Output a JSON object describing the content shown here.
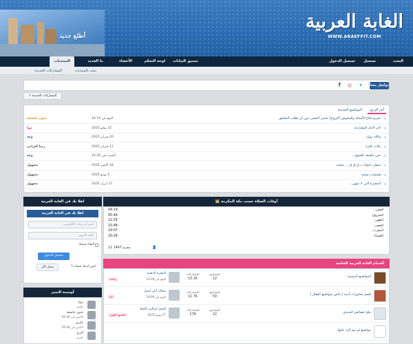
{
  "header": {
    "brand_title": "الغابة العربية",
    "brand_url": "WWW.ARAEFFIT.COM",
    "logo_caption": "أطلع جديد",
    "colors": {
      "header": "#2b6cb0",
      "nav": "#10263f",
      "accent": "#e8457c",
      "link": "#1f4e7d"
    }
  },
  "nav": {
    "items": [
      "المنتديات",
      "ما الجديد",
      "الأعضاء",
      "لوحة التحكم",
      "تنسيق البيانات",
      "تسجيل الدخول",
      "تسجيل",
      "البحث"
    ]
  },
  "subnav": {
    "items": [
      "المشاركات الجديدة",
      "بحث بالمنتديات"
    ]
  },
  "social": {
    "title": "تواصل معنا",
    "icons": [
      "twitter-icon",
      "instagram-icon",
      "facebook-icon"
    ]
  },
  "new_posts_label": "المشاركات الجديدة",
  "tabs": [
    "آخر الردود",
    "المواضيع الجديدة"
  ],
  "topics": [
    {
      "title": "تحريم فتاح الأسئلة والنصوص (الزواج) تحمي المعنى دون أن تطلب التحقيق",
      "date": "اليوم في 16:16",
      "user": "جنون عاشقة",
      "user_color": "#e39a1b"
    },
    {
      "title": "آخر أخبار المصارعة",
      "date": "21 يوليو 2025",
      "user": "مها",
      "user_color": "#e8457c"
    },
    {
      "title": "وكالة روح...",
      "date": "20 فبراير 2025",
      "user": "وعد",
      "user_color": "#2a4f7a"
    },
    {
      "title": "نكات نافرة",
      "date": "11 فبراير 2025",
      "user": "رضا الترابي",
      "user_color": "#555"
    },
    {
      "title": "حين يكشف الشوق...",
      "date": "السبت في 22:30",
      "user": "وعد",
      "user_color": "#2a4f7a"
    },
    {
      "title": "سجل دخولك بـ ق ق ق ...  متجدد",
      "date": "18 أكتوبر 2024",
      "user": "مجهول",
      "user_color": "#555"
    },
    {
      "title": "همسات نسمة",
      "date": "5 يونيو 2025",
      "user": "مجهول",
      "user_color": "#555"
    },
    {
      "title": "المحبرة التي لا تنتهي...",
      "date": "27 أبريل 2025",
      "user": "مجهول",
      "user_color": "#555"
    }
  ],
  "prayer": {
    "title": "أوقات الصلاة حسب مكة المكرمة",
    "rows": [
      {
        "label": "الفجر:",
        "time": "04:19"
      },
      {
        "label": "الشروق:",
        "time": "05:44"
      },
      {
        "label": "الظهر:",
        "time": "12:25"
      },
      {
        "label": "العصر:",
        "time": "15:48"
      },
      {
        "label": "المغرب:",
        "time": "19:07"
      },
      {
        "label": "العشاء:",
        "time": "20:26"
      }
    ],
    "hijri": "11 محرم 1447"
  },
  "forums": {
    "title": "أقسام الغابة العربية الخاصة",
    "rows": [
      {
        "name": "المواضيع المميزة",
        "topics": "12",
        "posts": "10.1K",
        "last_title": "المجرة الذهبية",
        "last_date": "اليوم في 13:28",
        "last_user": "راشد",
        "topics_label": "المواضيع",
        "posts_label": "المشاركات"
      },
      {
        "name": "قسم محاورات أدبية | خاص بمواضيع الفعال |",
        "topics": "50",
        "posts": "11.7K",
        "last_title": "سجال آنان جميل",
        "last_date": "اليوم في 16:09",
        "last_user": "أنا",
        "topics_label": "المواضيع",
        "posts_label": "المشاركات"
      },
      {
        "name": "ملخ حصائص المنتدى",
        "topics": "22",
        "posts": "278",
        "last_title": "أفضل اساليب للخط",
        "last_date": "27 يونيو 2025",
        "last_user": "عاشق الورد",
        "topics_label": "المواضيع",
        "posts_label": "المشاركات"
      },
      {
        "name": "مواضيع لم يتم الرد عليها",
        "topics": "",
        "posts": "",
        "last_title": "",
        "last_date": "",
        "last_user": "",
        "topics_label": "",
        "posts_label": ""
      }
    ]
  },
  "login": {
    "header": "اهلا بك في الغابة العربية",
    "title": "اهلا بك في الغابة العربية",
    "username_placeholder": "اسم أو بريدك الإلكتروني",
    "password_placeholder": "كلمة المرور",
    "remember": "البقاء متصلا",
    "login_btn": "تسجيل الدخول",
    "no_account": "ليس لديك حساب؟",
    "register_btn": "سجل الآن"
  },
  "active": {
    "title": "أوسمة التميز",
    "items": [
      {
        "name": "زوج",
        "sub": "تكريم"
      },
      {
        "name": "جنون عاشقة",
        "sub": "الأمس في 09:48"
      },
      {
        "name": "تكريم",
        "sub": "الأمس في 09:48"
      },
      {
        "name": "آخرج",
        "sub": "تكريم"
      }
    ]
  }
}
